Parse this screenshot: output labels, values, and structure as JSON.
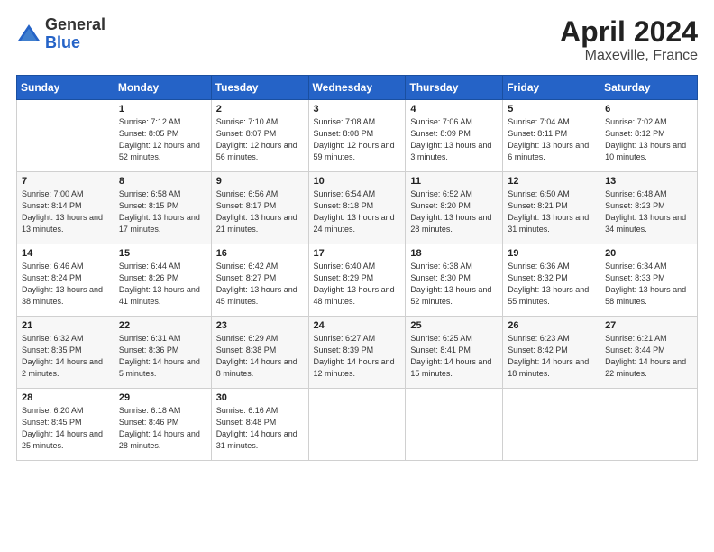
{
  "logo": {
    "general": "General",
    "blue": "Blue"
  },
  "title": {
    "month_year": "April 2024",
    "location": "Maxeville, France"
  },
  "days_of_week": [
    "Sunday",
    "Monday",
    "Tuesday",
    "Wednesday",
    "Thursday",
    "Friday",
    "Saturday"
  ],
  "weeks": [
    [
      {
        "day": "",
        "sunrise": "",
        "sunset": "",
        "daylight": ""
      },
      {
        "day": "1",
        "sunrise": "Sunrise: 7:12 AM",
        "sunset": "Sunset: 8:05 PM",
        "daylight": "Daylight: 12 hours and 52 minutes."
      },
      {
        "day": "2",
        "sunrise": "Sunrise: 7:10 AM",
        "sunset": "Sunset: 8:07 PM",
        "daylight": "Daylight: 12 hours and 56 minutes."
      },
      {
        "day": "3",
        "sunrise": "Sunrise: 7:08 AM",
        "sunset": "Sunset: 8:08 PM",
        "daylight": "Daylight: 12 hours and 59 minutes."
      },
      {
        "day": "4",
        "sunrise": "Sunrise: 7:06 AM",
        "sunset": "Sunset: 8:09 PM",
        "daylight": "Daylight: 13 hours and 3 minutes."
      },
      {
        "day": "5",
        "sunrise": "Sunrise: 7:04 AM",
        "sunset": "Sunset: 8:11 PM",
        "daylight": "Daylight: 13 hours and 6 minutes."
      },
      {
        "day": "6",
        "sunrise": "Sunrise: 7:02 AM",
        "sunset": "Sunset: 8:12 PM",
        "daylight": "Daylight: 13 hours and 10 minutes."
      }
    ],
    [
      {
        "day": "7",
        "sunrise": "Sunrise: 7:00 AM",
        "sunset": "Sunset: 8:14 PM",
        "daylight": "Daylight: 13 hours and 13 minutes."
      },
      {
        "day": "8",
        "sunrise": "Sunrise: 6:58 AM",
        "sunset": "Sunset: 8:15 PM",
        "daylight": "Daylight: 13 hours and 17 minutes."
      },
      {
        "day": "9",
        "sunrise": "Sunrise: 6:56 AM",
        "sunset": "Sunset: 8:17 PM",
        "daylight": "Daylight: 13 hours and 21 minutes."
      },
      {
        "day": "10",
        "sunrise": "Sunrise: 6:54 AM",
        "sunset": "Sunset: 8:18 PM",
        "daylight": "Daylight: 13 hours and 24 minutes."
      },
      {
        "day": "11",
        "sunrise": "Sunrise: 6:52 AM",
        "sunset": "Sunset: 8:20 PM",
        "daylight": "Daylight: 13 hours and 28 minutes."
      },
      {
        "day": "12",
        "sunrise": "Sunrise: 6:50 AM",
        "sunset": "Sunset: 8:21 PM",
        "daylight": "Daylight: 13 hours and 31 minutes."
      },
      {
        "day": "13",
        "sunrise": "Sunrise: 6:48 AM",
        "sunset": "Sunset: 8:23 PM",
        "daylight": "Daylight: 13 hours and 34 minutes."
      }
    ],
    [
      {
        "day": "14",
        "sunrise": "Sunrise: 6:46 AM",
        "sunset": "Sunset: 8:24 PM",
        "daylight": "Daylight: 13 hours and 38 minutes."
      },
      {
        "day": "15",
        "sunrise": "Sunrise: 6:44 AM",
        "sunset": "Sunset: 8:26 PM",
        "daylight": "Daylight: 13 hours and 41 minutes."
      },
      {
        "day": "16",
        "sunrise": "Sunrise: 6:42 AM",
        "sunset": "Sunset: 8:27 PM",
        "daylight": "Daylight: 13 hours and 45 minutes."
      },
      {
        "day": "17",
        "sunrise": "Sunrise: 6:40 AM",
        "sunset": "Sunset: 8:29 PM",
        "daylight": "Daylight: 13 hours and 48 minutes."
      },
      {
        "day": "18",
        "sunrise": "Sunrise: 6:38 AM",
        "sunset": "Sunset: 8:30 PM",
        "daylight": "Daylight: 13 hours and 52 minutes."
      },
      {
        "day": "19",
        "sunrise": "Sunrise: 6:36 AM",
        "sunset": "Sunset: 8:32 PM",
        "daylight": "Daylight: 13 hours and 55 minutes."
      },
      {
        "day": "20",
        "sunrise": "Sunrise: 6:34 AM",
        "sunset": "Sunset: 8:33 PM",
        "daylight": "Daylight: 13 hours and 58 minutes."
      }
    ],
    [
      {
        "day": "21",
        "sunrise": "Sunrise: 6:32 AM",
        "sunset": "Sunset: 8:35 PM",
        "daylight": "Daylight: 14 hours and 2 minutes."
      },
      {
        "day": "22",
        "sunrise": "Sunrise: 6:31 AM",
        "sunset": "Sunset: 8:36 PM",
        "daylight": "Daylight: 14 hours and 5 minutes."
      },
      {
        "day": "23",
        "sunrise": "Sunrise: 6:29 AM",
        "sunset": "Sunset: 8:38 PM",
        "daylight": "Daylight: 14 hours and 8 minutes."
      },
      {
        "day": "24",
        "sunrise": "Sunrise: 6:27 AM",
        "sunset": "Sunset: 8:39 PM",
        "daylight": "Daylight: 14 hours and 12 minutes."
      },
      {
        "day": "25",
        "sunrise": "Sunrise: 6:25 AM",
        "sunset": "Sunset: 8:41 PM",
        "daylight": "Daylight: 14 hours and 15 minutes."
      },
      {
        "day": "26",
        "sunrise": "Sunrise: 6:23 AM",
        "sunset": "Sunset: 8:42 PM",
        "daylight": "Daylight: 14 hours and 18 minutes."
      },
      {
        "day": "27",
        "sunrise": "Sunrise: 6:21 AM",
        "sunset": "Sunset: 8:44 PM",
        "daylight": "Daylight: 14 hours and 22 minutes."
      }
    ],
    [
      {
        "day": "28",
        "sunrise": "Sunrise: 6:20 AM",
        "sunset": "Sunset: 8:45 PM",
        "daylight": "Daylight: 14 hours and 25 minutes."
      },
      {
        "day": "29",
        "sunrise": "Sunrise: 6:18 AM",
        "sunset": "Sunset: 8:46 PM",
        "daylight": "Daylight: 14 hours and 28 minutes."
      },
      {
        "day": "30",
        "sunrise": "Sunrise: 6:16 AM",
        "sunset": "Sunset: 8:48 PM",
        "daylight": "Daylight: 14 hours and 31 minutes."
      },
      {
        "day": "",
        "sunrise": "",
        "sunset": "",
        "daylight": ""
      },
      {
        "day": "",
        "sunrise": "",
        "sunset": "",
        "daylight": ""
      },
      {
        "day": "",
        "sunrise": "",
        "sunset": "",
        "daylight": ""
      },
      {
        "day": "",
        "sunrise": "",
        "sunset": "",
        "daylight": ""
      }
    ]
  ]
}
